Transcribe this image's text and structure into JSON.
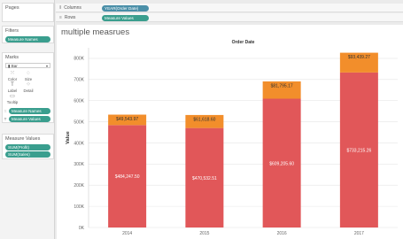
{
  "left": {
    "pages": {
      "title": "Pages"
    },
    "filters": {
      "title": "Filters",
      "items": [
        "Measure Names"
      ]
    },
    "marks": {
      "title": "Marks",
      "type": "Bar",
      "buttons": [
        {
          "label": "Color",
          "icon": "color-icon"
        },
        {
          "label": "Size",
          "icon": "size-icon"
        },
        {
          "label": "Label",
          "icon": "label-icon"
        },
        {
          "label": "Detail",
          "icon": "detail-icon"
        },
        {
          "label": "Tooltip",
          "icon": "tooltip-icon"
        }
      ],
      "fields": [
        {
          "label": "Measure Names",
          "icon": "color-icon"
        },
        {
          "label": "Measure Values",
          "icon": "label-icon"
        }
      ]
    },
    "measure_values": {
      "title": "Measure Values",
      "items": [
        "SUM(Profit)",
        "SUM(Sales)"
      ]
    }
  },
  "shelves": {
    "columns": {
      "label": "Columns",
      "pill": "YEAR(Order Date)"
    },
    "rows": {
      "label": "Rows",
      "pill": "Measure Values"
    }
  },
  "view": {
    "title": "multiple measrues"
  },
  "chart_data": {
    "type": "bar",
    "stacked": true,
    "header": "Order Date",
    "ylabel": "Value",
    "categories": [
      "2014",
      "2015",
      "2016",
      "2017"
    ],
    "ylim": [
      0,
      850000
    ],
    "yticks": [
      0,
      100000,
      200000,
      300000,
      400000,
      500000,
      600000,
      700000,
      800000
    ],
    "ytick_labels": [
      "0K",
      "100K",
      "200K",
      "300K",
      "400K",
      "500K",
      "600K",
      "700K",
      "800K"
    ],
    "series": [
      {
        "values": [
          484247.5,
          470532.51,
          609205.6,
          733215.26
        ],
        "labels": [
          "$484,247.50",
          "$470,532.51",
          "$609,205.60",
          "$733,215.26"
        ],
        "color": "#e15759"
      },
      {
        "values": [
          49543.97,
          61618.6,
          81795.17,
          93439.27
        ],
        "labels": [
          "$49,543.97",
          "$61,618.60",
          "$81,795.17",
          "$93,439.27"
        ],
        "color": "#f28e2b"
      }
    ],
    "grid": true
  }
}
